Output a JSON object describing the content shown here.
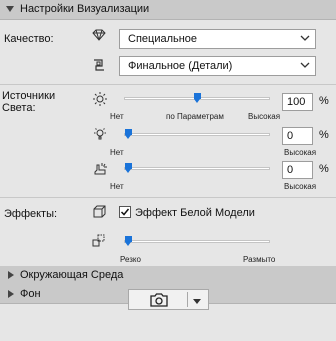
{
  "header": {
    "title": "Настройки Визуализации"
  },
  "quality": {
    "label": "Качество:",
    "value1": "Специальное",
    "value2": "Финальное (Детали)"
  },
  "lights": {
    "label": "Источники Света:",
    "sun": {
      "min": "Нет",
      "mid": "по Параметрам",
      "max": "Высокая",
      "value": "100",
      "unit": "%",
      "level": 0.45
    },
    "lamp": {
      "min": "Нет",
      "max": "Высокая",
      "value": "0",
      "unit": "%",
      "level": 0.0
    },
    "hand": {
      "min": "Нет",
      "max": "Высокая",
      "value": "0",
      "unit": "%",
      "level": 0.0
    }
  },
  "effects": {
    "label": "Эффекты:",
    "white_model": {
      "label": "Эффект Белой Модели",
      "checked": true
    },
    "blur": {
      "min": "Резко",
      "max": "Размыто",
      "level": 0.0
    }
  },
  "sections": {
    "environment": "Окружающая Среда",
    "background": "Фон"
  },
  "colors": {
    "accent": "#1a73d9",
    "panel": "#e6e6e6",
    "header": "#c9c9c9"
  }
}
